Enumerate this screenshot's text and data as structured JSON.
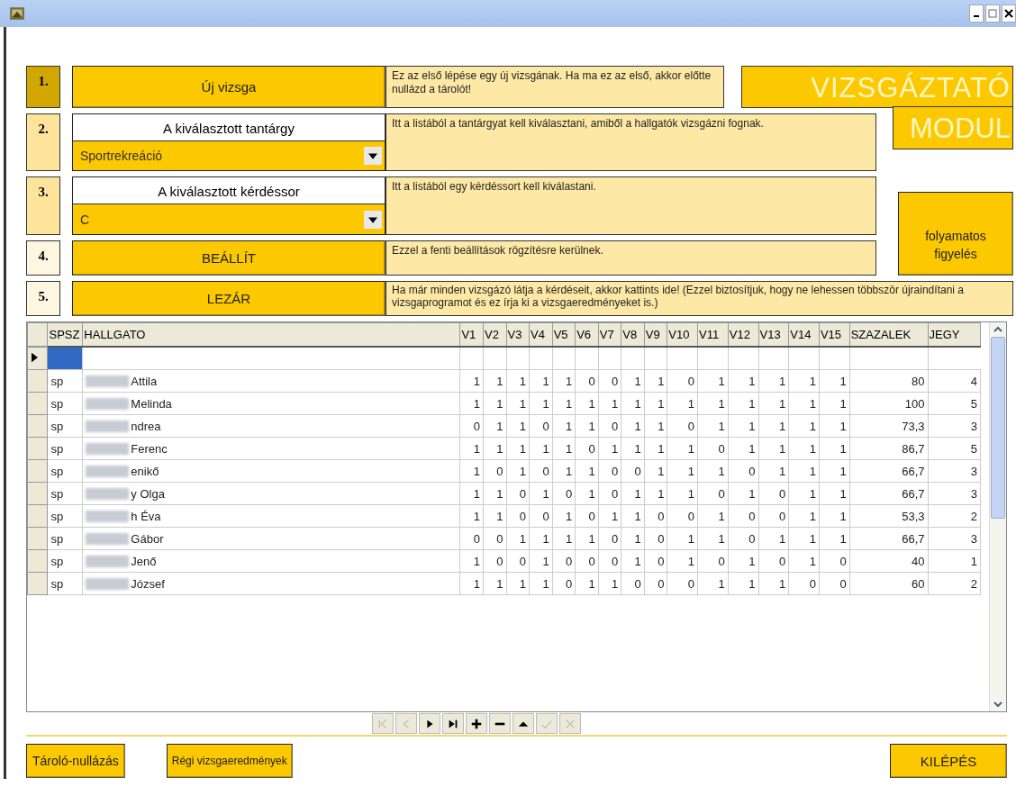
{
  "steps": [
    {
      "number": "1.",
      "color": "#d2a800",
      "kind": "button",
      "label": "Új vizsga",
      "description": "Ez az első lépése egy új vizsgának. Ha ma ez az első, akkor előtte nullázd a tárolót!"
    },
    {
      "number": "2.",
      "color": "#fde49a",
      "kind": "select",
      "label": "A kiválasztott tantárgy",
      "value": "Sportrekreáció",
      "description": "Itt a listából a tantárgyat kell kiválasztani, amiből a hallgatók vizsgázni fognak."
    },
    {
      "number": "3.",
      "color": "#fde49a",
      "kind": "select",
      "label": "A kiválasztott kérdéssor",
      "value": "C",
      "description": "Itt a listából egy kérdéssort kell kiválastani."
    },
    {
      "number": "4.",
      "color": "#fdf6e0",
      "kind": "button",
      "label": "BEÁLLÍT",
      "description": "Ezzel a fenti beállítások rögzítésre kerülnek."
    },
    {
      "number": "5.",
      "color": "#fdf6e0",
      "kind": "button",
      "label": "LEZÁR",
      "description": "Ha már minden vizsgázó látja a kérdéseit, akkor kattints ide! (Ezzel biztosítjuk, hogy ne lehessen többször újraindítani a vizsgaprogramot és ez írja ki a vizsgaeredményeket is.)"
    }
  ],
  "module_title": [
    "VIZSGÁZTATÓ",
    "MODUL"
  ],
  "monitor_button": "folyamatos figyelés",
  "table": {
    "columns": [
      "SPSZ",
      "HALLGATO",
      "V1",
      "V2",
      "V3",
      "V4",
      "V5",
      "V6",
      "V7",
      "V8",
      "V9",
      "V10",
      "V11",
      "V12",
      "V13",
      "V14",
      "V15",
      "SZAZALEK",
      "JEGY"
    ],
    "new_row": {
      "selected": true
    },
    "rows": [
      {
        "spsz": "sp",
        "name": "Attila",
        "answers": [
          "1",
          "1",
          "1",
          "1",
          "1",
          "0",
          "0",
          "1",
          "1",
          "0",
          "1",
          "1",
          "1",
          "1",
          "1"
        ],
        "percent": "80",
        "grade": "4"
      },
      {
        "spsz": "sp",
        "name": "Melinda",
        "answers": [
          "1",
          "1",
          "1",
          "1",
          "1",
          "1",
          "1",
          "1",
          "1",
          "1",
          "1",
          "1",
          "1",
          "1",
          "1"
        ],
        "percent": "100",
        "grade": "5"
      },
      {
        "spsz": "sp",
        "name": "ndrea",
        "answers": [
          "0",
          "1",
          "1",
          "0",
          "1",
          "1",
          "0",
          "1",
          "1",
          "0",
          "1",
          "1",
          "1",
          "1",
          "1"
        ],
        "percent": "73,3",
        "grade": "3"
      },
      {
        "spsz": "sp",
        "name": "Ferenc",
        "answers": [
          "1",
          "1",
          "1",
          "1",
          "1",
          "0",
          "1",
          "1",
          "1",
          "1",
          "0",
          "1",
          "1",
          "1",
          "1"
        ],
        "percent": "86,7",
        "grade": "5"
      },
      {
        "spsz": "sp",
        "name": "enikő",
        "answers": [
          "1",
          "0",
          "1",
          "0",
          "1",
          "1",
          "0",
          "0",
          "1",
          "1",
          "1",
          "0",
          "1",
          "1",
          "1"
        ],
        "percent": "66,7",
        "grade": "3"
      },
      {
        "spsz": "sp",
        "name": "y Olga",
        "answers": [
          "1",
          "1",
          "0",
          "1",
          "0",
          "1",
          "0",
          "1",
          "1",
          "1",
          "0",
          "1",
          "0",
          "1",
          "1"
        ],
        "percent": "66,7",
        "grade": "3"
      },
      {
        "spsz": "sp",
        "name": "h Éva",
        "answers": [
          "1",
          "1",
          "0",
          "0",
          "1",
          "0",
          "1",
          "1",
          "0",
          "0",
          "1",
          "0",
          "0",
          "1",
          "1"
        ],
        "percent": "53,3",
        "grade": "2"
      },
      {
        "spsz": "sp",
        "name": "Gábor",
        "answers": [
          "0",
          "0",
          "1",
          "1",
          "1",
          "1",
          "0",
          "1",
          "0",
          "1",
          "1",
          "0",
          "1",
          "1",
          "1"
        ],
        "percent": "66,7",
        "grade": "3"
      },
      {
        "spsz": "sp",
        "name": "Jenő",
        "answers": [
          "1",
          "0",
          "0",
          "1",
          "0",
          "0",
          "0",
          "1",
          "0",
          "1",
          "0",
          "1",
          "0",
          "1",
          "0"
        ],
        "percent": "40",
        "grade": "1"
      },
      {
        "spsz": "sp",
        "name": "József",
        "answers": [
          "1",
          "1",
          "1",
          "1",
          "0",
          "1",
          "1",
          "0",
          "0",
          "0",
          "1",
          "1",
          "1",
          "0",
          "0"
        ],
        "percent": "60",
        "grade": "2"
      }
    ]
  },
  "navigator": [
    {
      "kind": "first",
      "disabled": true
    },
    {
      "kind": "prev",
      "disabled": true
    },
    {
      "kind": "next",
      "disabled": false
    },
    {
      "kind": "last",
      "disabled": false
    },
    {
      "kind": "add",
      "disabled": false
    },
    {
      "kind": "delete",
      "disabled": false
    },
    {
      "kind": "edit",
      "disabled": false
    },
    {
      "kind": "post",
      "disabled": true
    },
    {
      "kind": "cancel",
      "disabled": true
    }
  ],
  "bottom_buttons": {
    "reset": "Tároló-nullázás",
    "history": "Régi vizsgaeredmények",
    "exit": "KILÉPÉS"
  }
}
